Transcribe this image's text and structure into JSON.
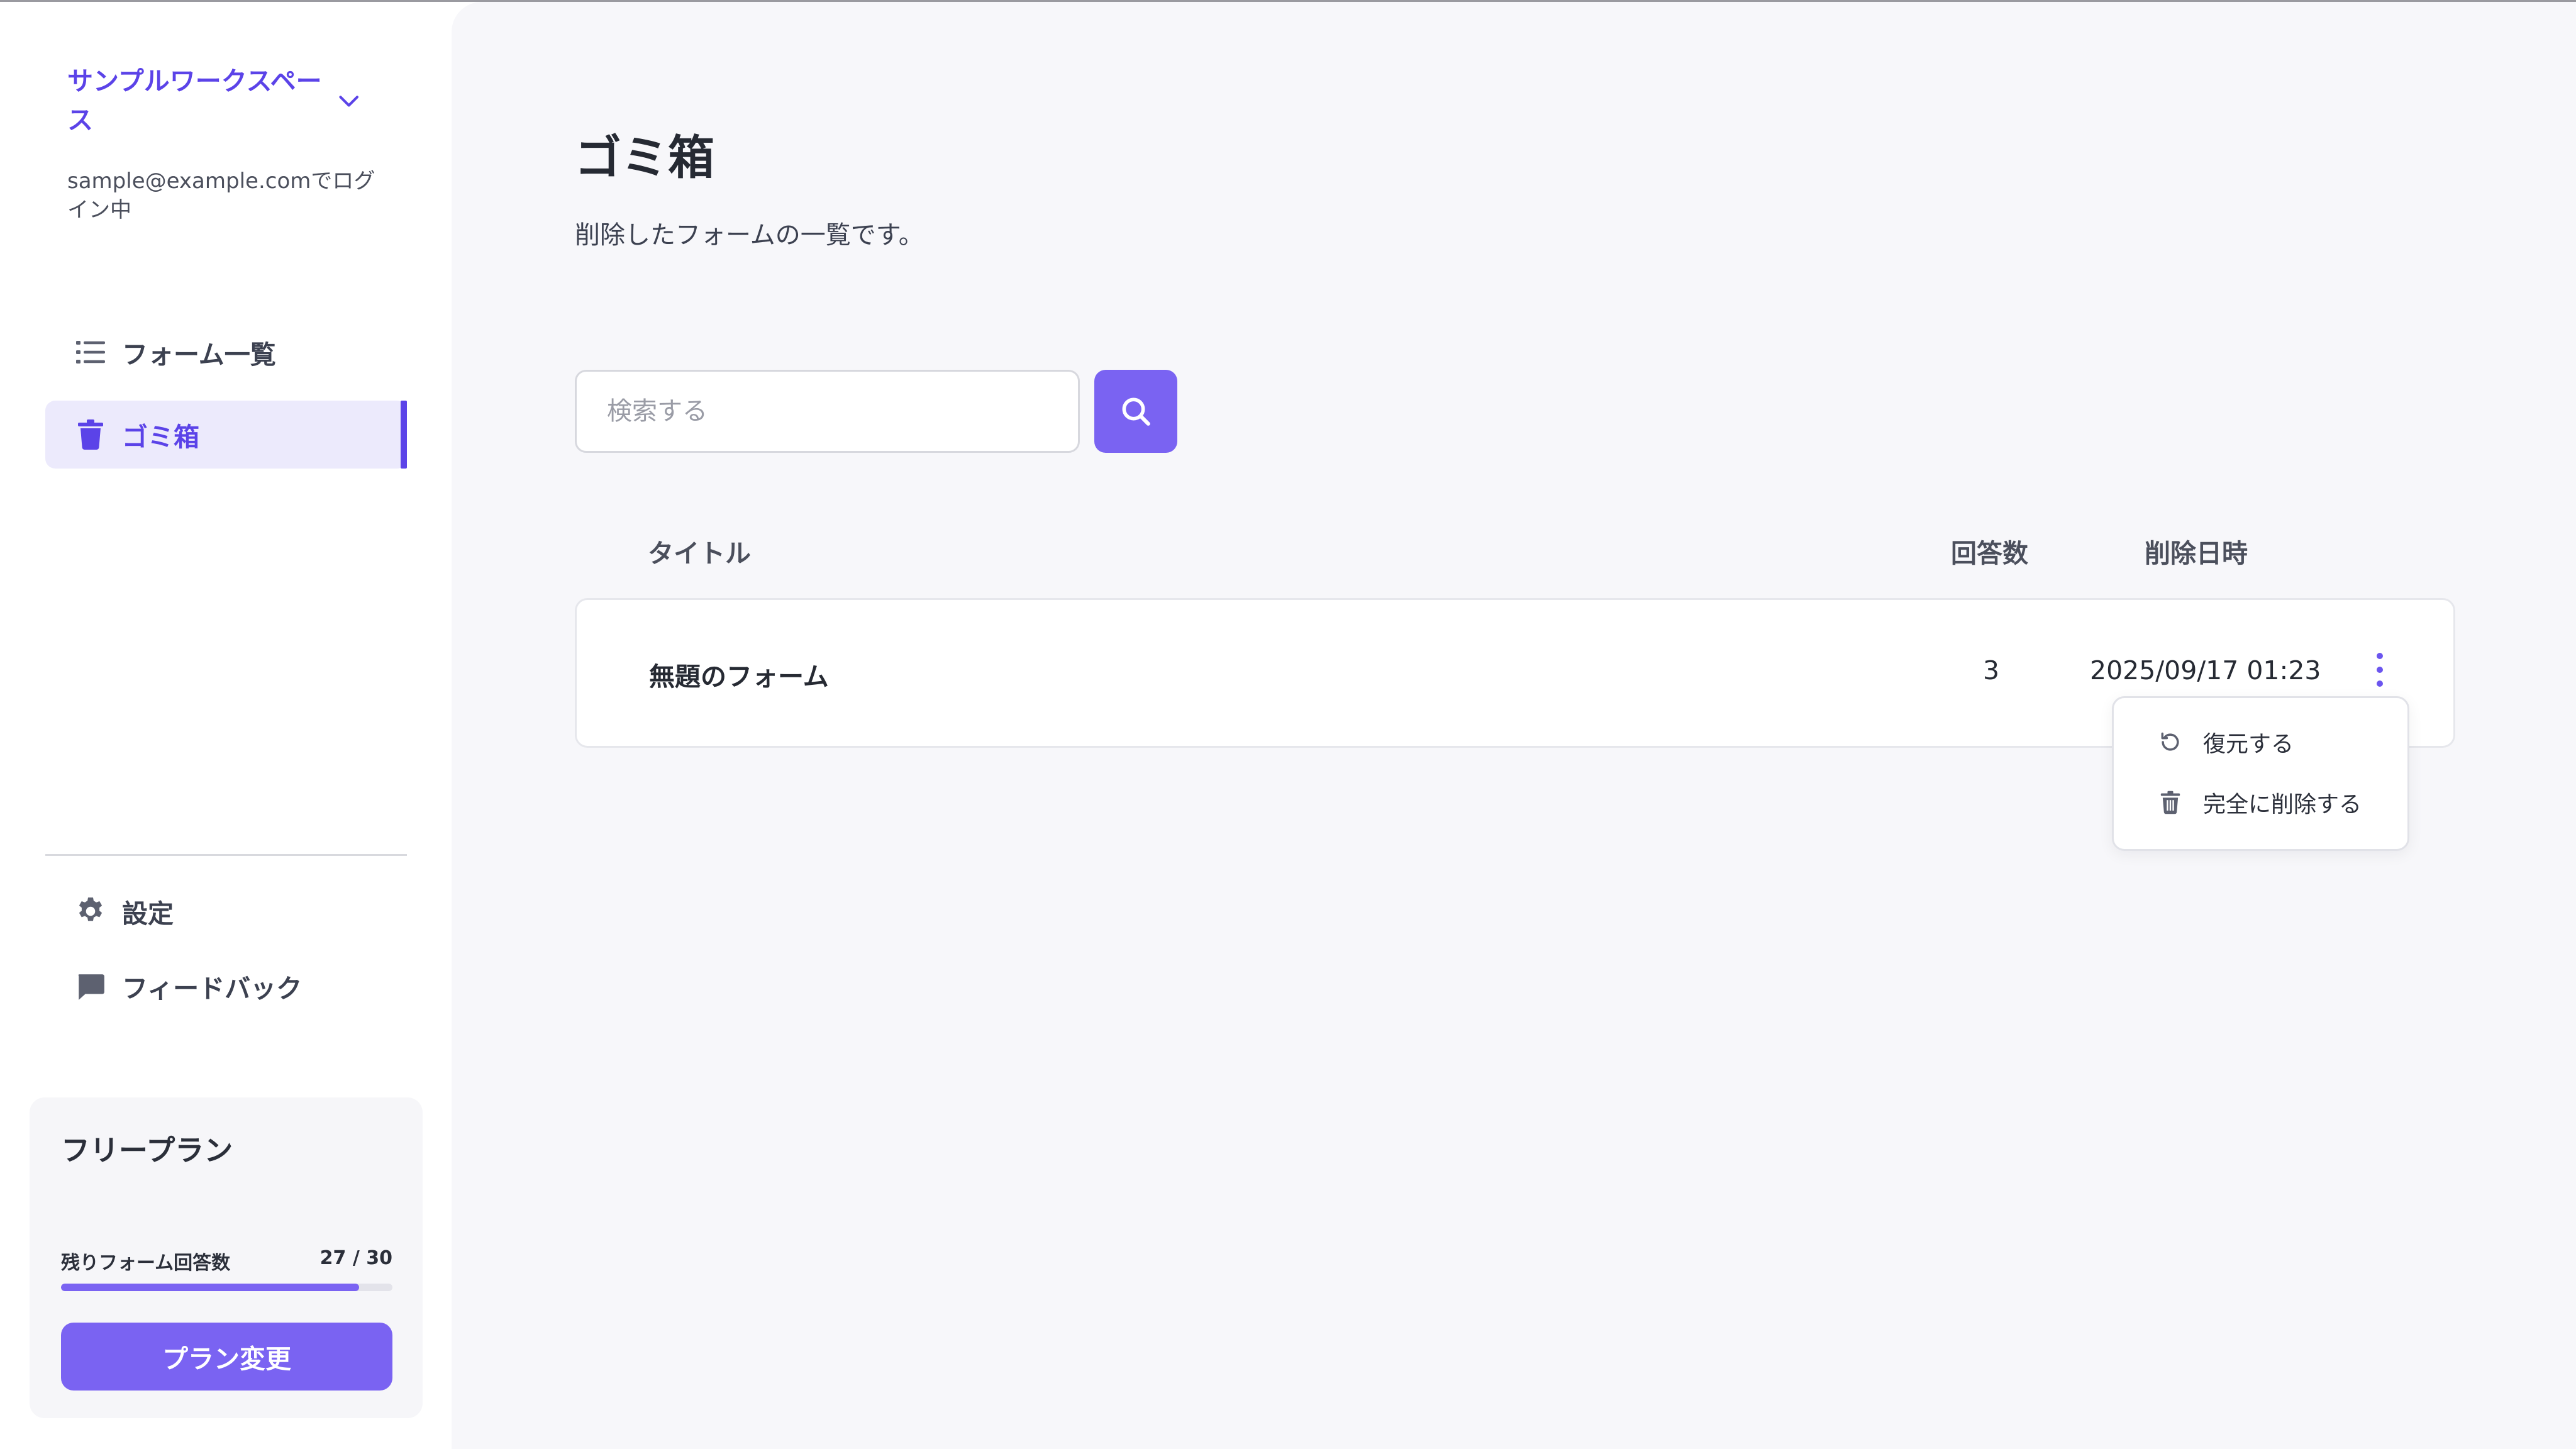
{
  "sidebar": {
    "workspace_name": "サンプルワークスペース",
    "login_text": "sample@example.comでログイン中",
    "nav_items": [
      {
        "label": "フォーム一覧",
        "icon": "list-icon",
        "active": false
      },
      {
        "label": "ゴミ箱",
        "icon": "trash-icon",
        "active": true
      }
    ],
    "bottom_items": [
      {
        "label": "設定",
        "icon": "gear-icon"
      },
      {
        "label": "フィードバック",
        "icon": "chat-bubble-icon"
      }
    ],
    "plan": {
      "title": "フリープラン",
      "remaining_label": "残りフォーム回答数",
      "remaining_value": "27 / 30",
      "progress": 0.9,
      "change_button": "プラン変更"
    }
  },
  "main": {
    "title": "ゴミ箱",
    "subtitle": "削除したフォームの一覧です。",
    "search": {
      "placeholder": "検索する",
      "value": ""
    },
    "table": {
      "columns": [
        "タイトル",
        "回答数",
        "削除日時"
      ],
      "rows": [
        {
          "title": "無題のフォーム",
          "responses": "3",
          "deleted_at": "2025/09/17 01:23"
        }
      ]
    },
    "row_menu": {
      "items": [
        {
          "label": "復元する",
          "icon": "restore-icon"
        },
        {
          "label": "完全に削除する",
          "icon": "trash-icon"
        }
      ]
    }
  },
  "colors": {
    "accent": "#7a63f2",
    "accent_dark": "#5b43e8",
    "main_bg": "#f7f7fa",
    "active_nav_bg": "#eceafc"
  }
}
